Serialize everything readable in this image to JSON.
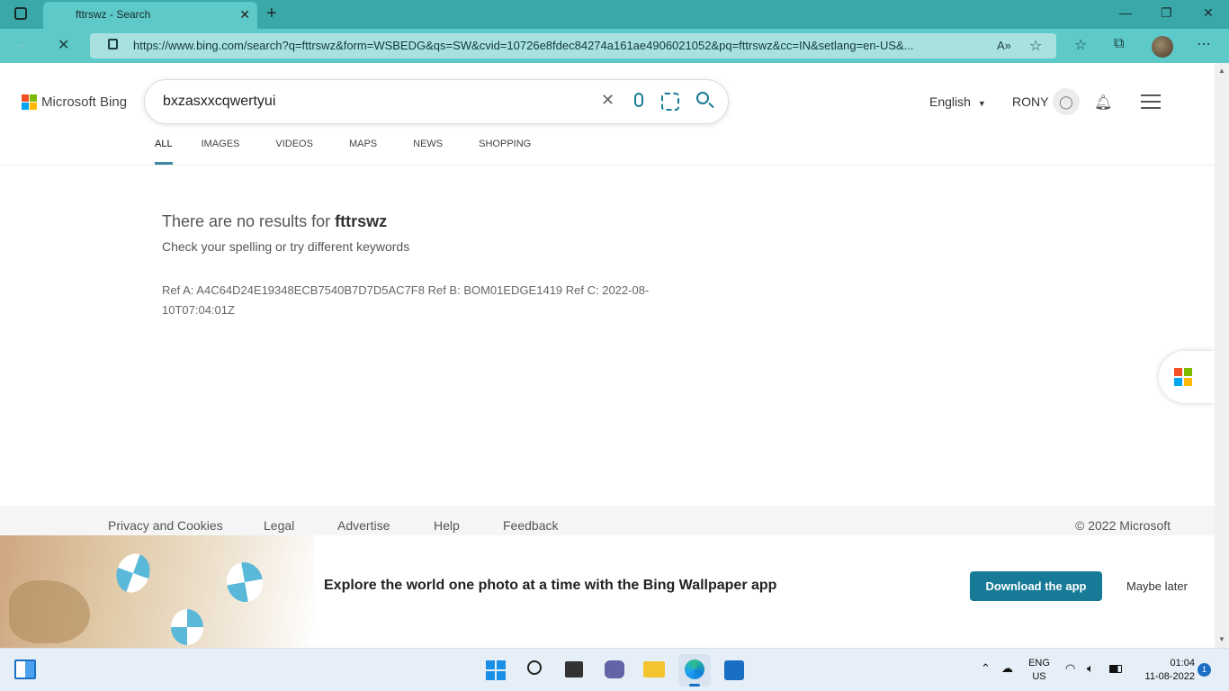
{
  "browser": {
    "tab_title": "fttrswz - Search",
    "url": "https://www.bing.com/search?q=fttrswz&form=WSBEDG&qs=SW&cvid=10726e8fdec84274a161ae4906021052&pq=fttrswz&cc=IN&setlang=en-US&..."
  },
  "header": {
    "logo": "Microsoft Bing",
    "search_value": "bxzasxxcqwertyui",
    "language": "English",
    "user": "RONY"
  },
  "tabs": [
    "ALL",
    "IMAGES",
    "VIDEOS",
    "MAPS",
    "NEWS",
    "SHOPPING"
  ],
  "results": {
    "no_results_prefix": "There are no results for ",
    "query": "fttrswz",
    "hint": "Check your spelling or try different keywords",
    "ref": "Ref A: A4C64D24E19348ECB7540B7D7D5AC7F8 Ref B: BOM01EDGE1419 Ref C: 2022-08-10T07:04:01Z"
  },
  "footer": {
    "links": [
      "Privacy and Cookies",
      "Legal",
      "Advertise",
      "Help",
      "Feedback"
    ],
    "copyright": "© 2022 Microsoft"
  },
  "banner": {
    "text": "Explore the world one photo at a time with the Bing Wallpaper app",
    "download": "Download the app",
    "dismiss": "Maybe later"
  },
  "taskbar": {
    "lang_top": "ENG",
    "lang_bottom": "US",
    "time": "01:04",
    "date": "11-08-2022",
    "notification_count": "1"
  },
  "colors": {
    "titlebar": "#3aa8a8",
    "accent": "#177a96"
  }
}
